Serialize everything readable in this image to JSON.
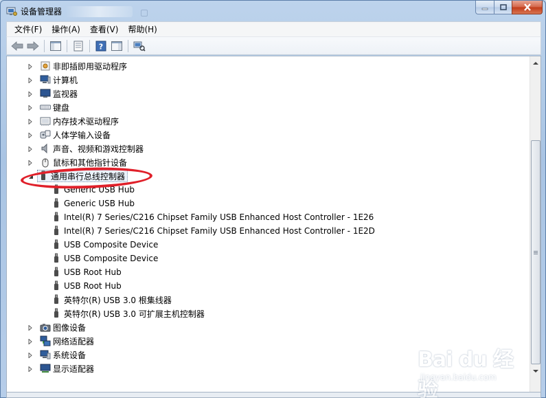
{
  "window": {
    "title": "设备管理器"
  },
  "menu": [
    {
      "label": "文件(F)"
    },
    {
      "label": "操作(A)"
    },
    {
      "label": "查看(V)"
    },
    {
      "label": "帮助(H)"
    }
  ],
  "toolbar": {
    "icons": [
      "back-arrow-icon",
      "forward-arrow-icon",
      "show-hide-console-tree-icon",
      "properties-icon",
      "help-icon",
      "action-pane-icon",
      "scan-hardware-icon"
    ]
  },
  "tree": {
    "categories_top": [
      {
        "label": "非即插即用驱动程序",
        "icon": "driver-icon"
      },
      {
        "label": "计算机",
        "icon": "computer-icon"
      },
      {
        "label": "监视器",
        "icon": "monitor-icon"
      },
      {
        "label": "键盘",
        "icon": "keyboard-icon"
      },
      {
        "label": "内存技术驱动程序",
        "icon": "memory-icon"
      },
      {
        "label": "人体学输入设备",
        "icon": "hid-icon"
      },
      {
        "label": "声音、视频和游戏控制器",
        "icon": "speaker-icon"
      },
      {
        "label": "鼠标和其他指针设备",
        "icon": "mouse-icon"
      }
    ],
    "expanded_category": {
      "label": "通用串行总线控制器",
      "icon": "usb-icon"
    },
    "usb_children": [
      {
        "label": "Generic USB Hub"
      },
      {
        "label": "Generic USB Hub"
      },
      {
        "label": "Intel(R) 7 Series/C216 Chipset Family USB Enhanced Host Controller - 1E26"
      },
      {
        "label": "Intel(R) 7 Series/C216 Chipset Family USB Enhanced Host Controller - 1E2D"
      },
      {
        "label": "USB Composite Device"
      },
      {
        "label": "USB Composite Device"
      },
      {
        "label": "USB Root Hub"
      },
      {
        "label": "USB Root Hub"
      },
      {
        "label": "英特尔(R) USB 3.0 根集线器"
      },
      {
        "label": "英特尔(R) USB 3.0 可扩展主机控制器"
      }
    ],
    "categories_bottom": [
      {
        "label": "图像设备",
        "icon": "camera-icon"
      },
      {
        "label": "网络适配器",
        "icon": "network-icon"
      },
      {
        "label": "系统设备",
        "icon": "system-icon"
      },
      {
        "label": "显示适配器",
        "icon": "display-icon"
      }
    ]
  },
  "watermark": {
    "logo": "Bai du 经验",
    "url": "jingyan.baidu.com"
  },
  "colors": {
    "highlight_circle": "#e0202a",
    "selection_bg": "#eaf2fb"
  }
}
